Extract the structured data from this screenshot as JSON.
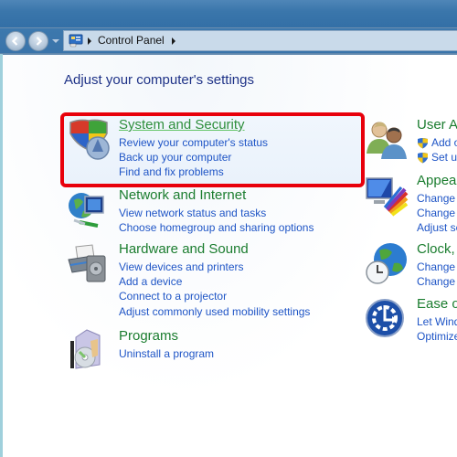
{
  "window": {
    "address_bar": {
      "icon": "control-panel-icon",
      "breadcrumbs": [
        "Control Panel"
      ]
    },
    "nav": {
      "back": "back-arrow-icon",
      "forward": "forward-arrow-icon",
      "history": "chevron-down-icon"
    }
  },
  "main": {
    "title": "Adjust your computer's settings",
    "highlight_color": "#e8000b",
    "categories_left": [
      {
        "icon": "shield-icon",
        "title": "System and Security",
        "highlighted": true,
        "links": [
          "Review your computer's status",
          "Back up your computer",
          "Find and fix problems"
        ]
      },
      {
        "icon": "network-icon",
        "title": "Network and Internet",
        "links": [
          "View network status and tasks",
          "Choose homegroup and sharing options"
        ]
      },
      {
        "icon": "printer-icon",
        "title": "Hardware and Sound",
        "links": [
          "View devices and printers",
          "Add a device",
          "Connect to a projector",
          "Adjust commonly used mobility settings"
        ]
      },
      {
        "icon": "programs-icon",
        "title": "Programs",
        "links": [
          "Uninstall a program"
        ]
      }
    ],
    "categories_right": [
      {
        "icon": "users-icon",
        "title": "User Ac",
        "links": [
          "Add or",
          "Set up"
        ],
        "shielded_links": true
      },
      {
        "icon": "appearance-icon",
        "title": "Appear",
        "links": [
          "Change th",
          "Change d",
          "Adjust scr"
        ]
      },
      {
        "icon": "clock-globe-icon",
        "title": "Clock, L",
        "links": [
          "Change k",
          "Change d"
        ]
      },
      {
        "icon": "ease-of-access-icon",
        "title": "Ease of",
        "links": [
          "Let Windo",
          "Optimize"
        ]
      }
    ]
  },
  "colors": {
    "title_blue": "#1e3287",
    "category_green": "#1b7d2f",
    "link_blue": "#1f55c6"
  }
}
